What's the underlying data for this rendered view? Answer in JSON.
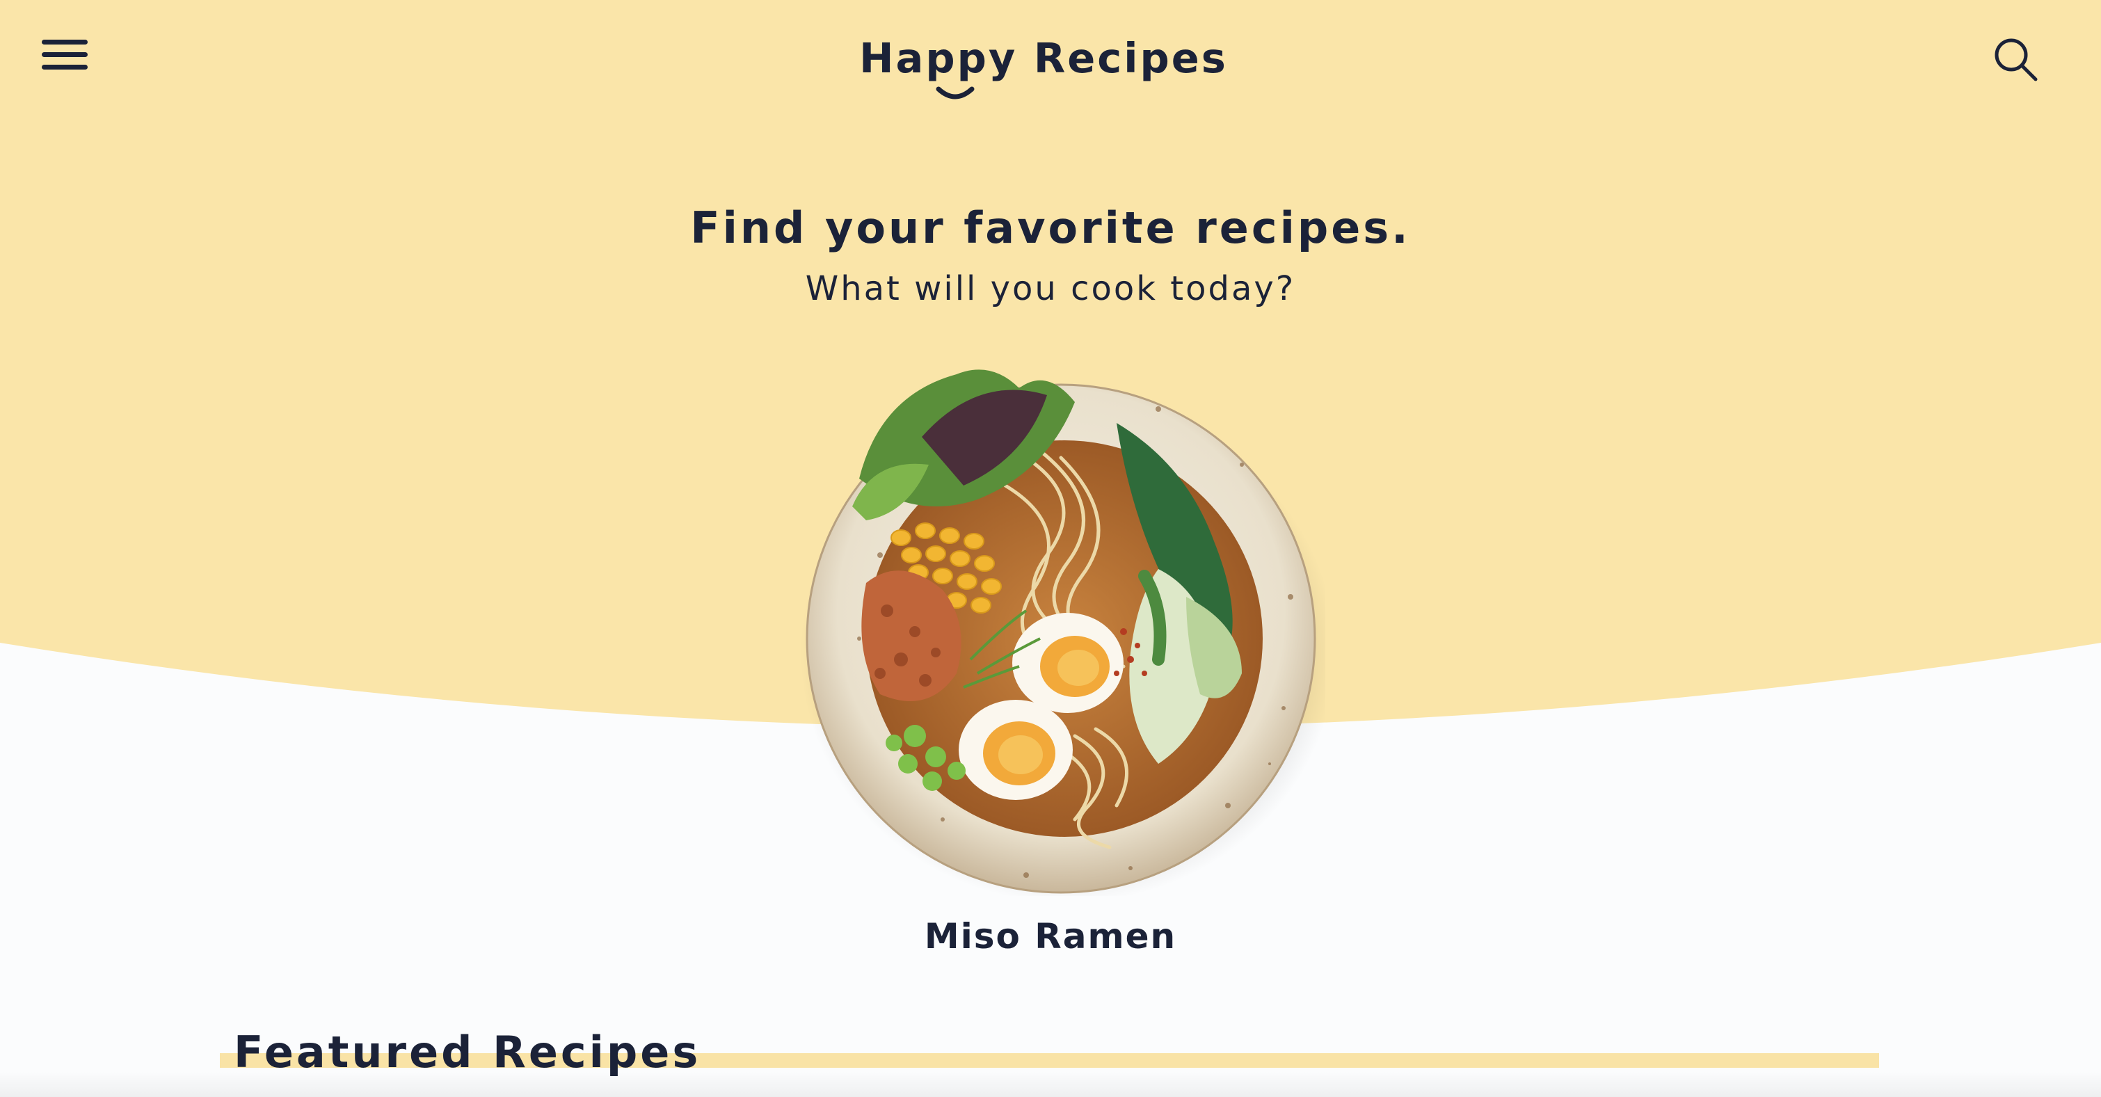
{
  "brand": {
    "name": "Happy Recipes"
  },
  "header": {
    "menu_icon": "hamburger-menu-icon",
    "search_icon": "search-icon"
  },
  "hero": {
    "headline": "Find your favorite recipes.",
    "subheadline": "What will you cook today?",
    "dish": {
      "name": "Miso Ramen"
    }
  },
  "featured": {
    "title": "Featured Recipes"
  },
  "colors": {
    "hero_background": "#fae5a9",
    "page_background": "#fbfcfd",
    "text": "#1b2238",
    "accent_underline": "#f9e3a6"
  }
}
